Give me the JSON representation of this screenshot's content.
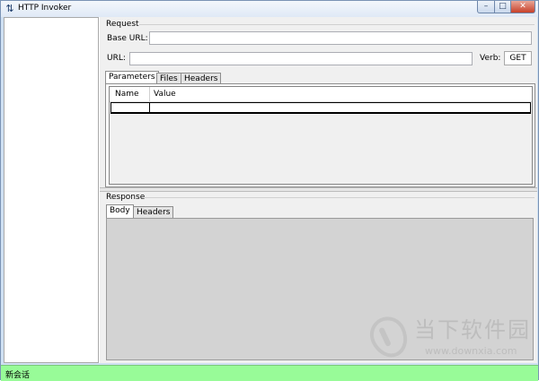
{
  "window": {
    "title": "HTTP Invoker",
    "controls": {
      "minimize": "–",
      "maximize": "□",
      "close": "✕"
    }
  },
  "request": {
    "group_label": "Request",
    "base_url_label": "Base URL:",
    "base_url_value": "",
    "url_label": "URL:",
    "url_value": "",
    "verb_label": "Verb:",
    "verb_value": "GET",
    "tabs": [
      {
        "label": "Parameters",
        "active": true
      },
      {
        "label": "Files",
        "active": false
      },
      {
        "label": "Headers",
        "active": false
      }
    ],
    "grid": {
      "columns": [
        "Name",
        "Value"
      ]
    }
  },
  "response": {
    "group_label": "Response",
    "tabs": [
      {
        "label": "Body",
        "active": true
      },
      {
        "label": "Headers",
        "active": false
      }
    ]
  },
  "status": {
    "text": "新会话",
    "color": "#98fb98"
  },
  "watermark": {
    "text": "当下软件园",
    "url": "www.downxia.com"
  }
}
